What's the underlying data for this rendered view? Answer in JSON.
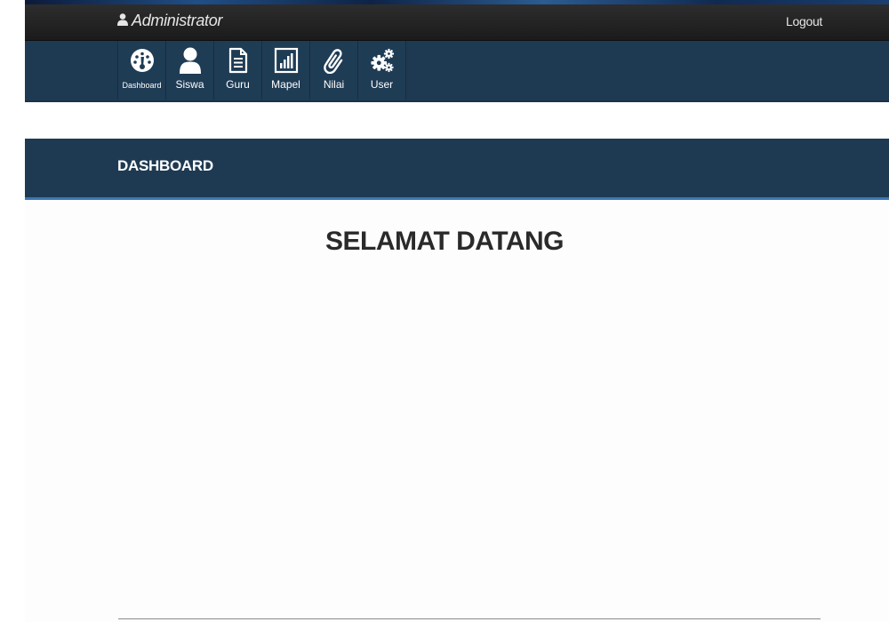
{
  "header": {
    "brand": "Administrator",
    "logout_label": "Logout"
  },
  "nav": {
    "items": [
      {
        "label": "Dashboard",
        "icon": "dashboard-gauge-icon"
      },
      {
        "label": "Siswa",
        "icon": "user-icon"
      },
      {
        "label": "Guru",
        "icon": "document-icon"
      },
      {
        "label": "Mapel",
        "icon": "bar-chart-icon"
      },
      {
        "label": "Nilai",
        "icon": "paperclip-icon"
      },
      {
        "label": "User",
        "icon": "gears-icon"
      }
    ]
  },
  "section": {
    "title": "DASHBOARD"
  },
  "main": {
    "welcome": "SELAMAT DATANG"
  },
  "colors": {
    "topbar": "#222222",
    "nav_band": "#1e3a52",
    "section_accent": "#3c77b5"
  }
}
